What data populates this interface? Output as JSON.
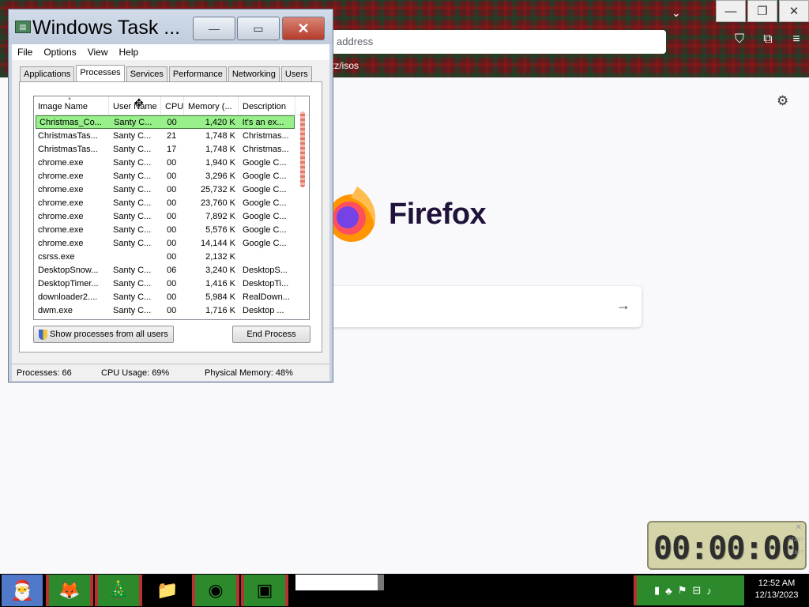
{
  "firefox": {
    "url_placeholder": "address",
    "bookmark": "tz/isos",
    "wordmark": "Firefox",
    "tab_chevron": "⌄",
    "caption": {
      "minimize": "—",
      "restore": "❐",
      "close": "✕"
    },
    "icons": {
      "pocket": "⛉",
      "extensions": "⧉",
      "menu": "≡",
      "settings": "⚙",
      "search_go": "→"
    }
  },
  "task_manager": {
    "title": "Windows Task ...",
    "caption": {
      "minimize": "—",
      "maximize": "▭",
      "close": "✕"
    },
    "menu": [
      "File",
      "Options",
      "View",
      "Help"
    ],
    "tabs": [
      "Applications",
      "Processes",
      "Services",
      "Performance",
      "Networking",
      "Users"
    ],
    "active_tab": "Processes",
    "columns": [
      "Image Name",
      "User Name",
      "CPU",
      "Memory (...",
      "Description"
    ],
    "rows": [
      [
        "Christmas_Co...",
        "Santy C...",
        "00",
        "1,420 K",
        "It's an ex..."
      ],
      [
        "ChristmasTas...",
        "Santy C...",
        "21",
        "1,748 K",
        "Christmas..."
      ],
      [
        "ChristmasTas...",
        "Santy C...",
        "17",
        "1,748 K",
        "Christmas..."
      ],
      [
        "chrome.exe",
        "Santy C...",
        "00",
        "1,940 K",
        "Google C..."
      ],
      [
        "chrome.exe",
        "Santy C...",
        "00",
        "3,296 K",
        "Google C..."
      ],
      [
        "chrome.exe",
        "Santy C...",
        "00",
        "25,732 K",
        "Google C..."
      ],
      [
        "chrome.exe",
        "Santy C...",
        "00",
        "23,760 K",
        "Google C..."
      ],
      [
        "chrome.exe",
        "Santy C...",
        "00",
        "7,892 K",
        "Google C..."
      ],
      [
        "chrome.exe",
        "Santy C...",
        "00",
        "5,576 K",
        "Google C..."
      ],
      [
        "chrome.exe",
        "Santy C...",
        "00",
        "14,144 K",
        "Google C..."
      ],
      [
        "csrss.exe",
        "",
        "00",
        "2,132 K",
        ""
      ],
      [
        "DesktopSnow...",
        "Santy C...",
        "06",
        "3,240 K",
        "DesktopS..."
      ],
      [
        "DesktopTimer...",
        "Santy C...",
        "00",
        "1,416 K",
        "DesktopTi..."
      ],
      [
        "downloader2....",
        "Santy C...",
        "00",
        "5,984 K",
        "RealDown..."
      ],
      [
        "dwm.exe",
        "Santy C...",
        "00",
        "1,716 K",
        "Desktop ..."
      ]
    ],
    "selected_row": 0,
    "show_all_button": "Show processes from all users",
    "end_process_button": "End Process",
    "status": {
      "processes": "Processes: 66",
      "cpu": "CPU Usage: 69%",
      "memory": "Physical Memory: 48%"
    }
  },
  "timer": {
    "display": "00:00:00",
    "close": "✕",
    "start": "START",
    "reset": "RESET"
  },
  "taskbar": {
    "clock_time": "12:52 AM",
    "clock_date": "12/13/2023",
    "tray_icons": [
      "▮",
      "♣",
      "⚑",
      "⊟",
      "♪"
    ],
    "apps": {
      "start": "🎅",
      "firefox": "🦊",
      "tree": "🎄",
      "folder": "📁",
      "chrome": "◉",
      "taskmgr": "▣"
    }
  }
}
